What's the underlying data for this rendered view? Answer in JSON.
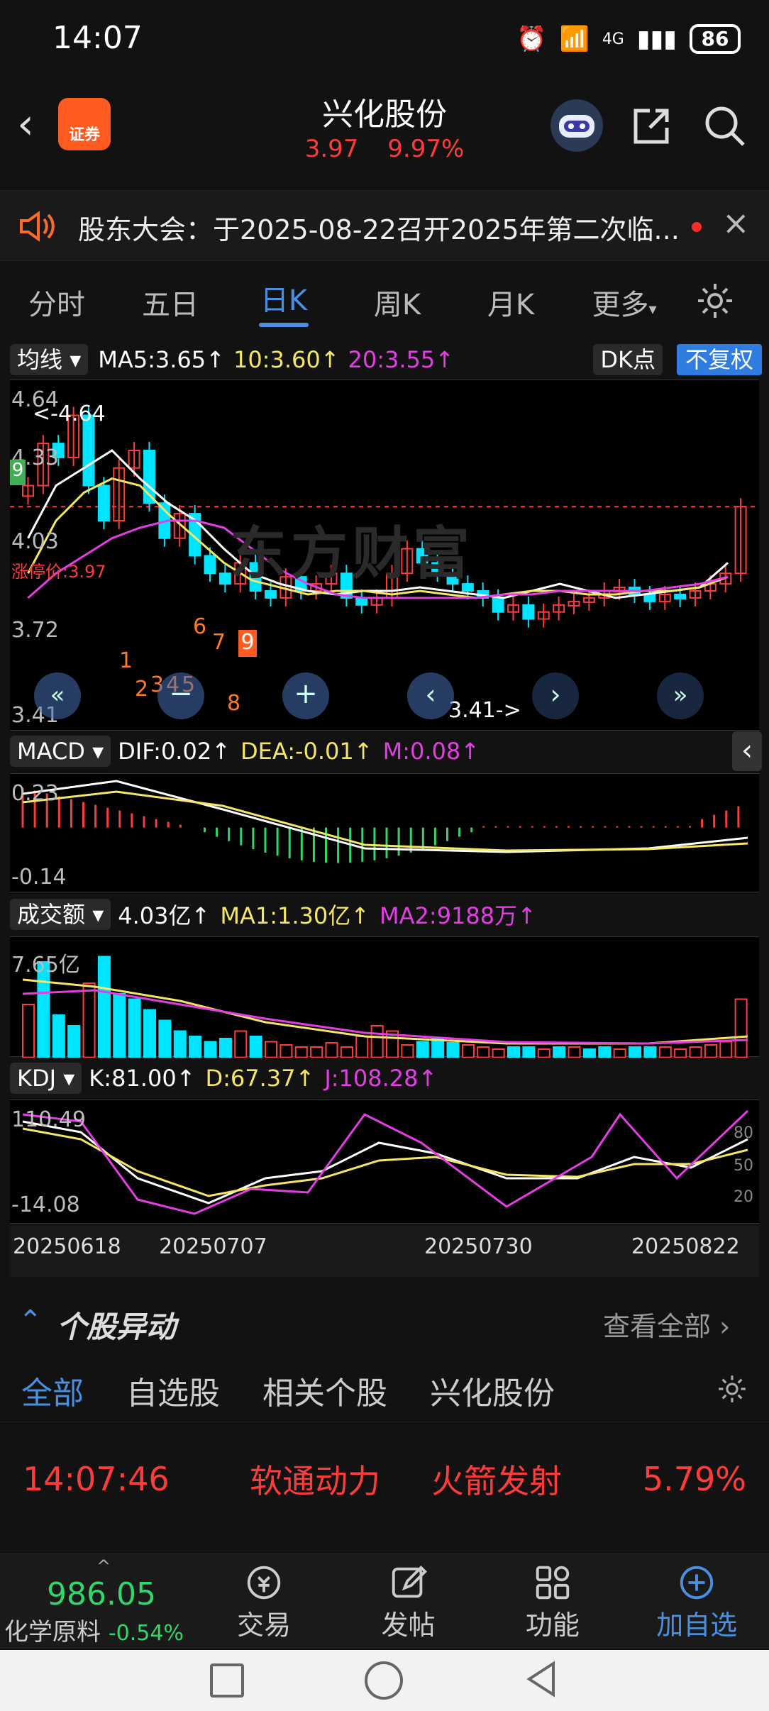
{
  "status": {
    "time": "14:07",
    "network": "4G",
    "battery": "86"
  },
  "header": {
    "title": "兴化股份",
    "price": "3.97",
    "change_pct": "9.97%",
    "logo_text": "证券"
  },
  "notice": {
    "text": "股东大会：于2025-08-22召开2025年第二次临..."
  },
  "tabs": [
    "分时",
    "五日",
    "日K",
    "周K",
    "月K",
    "更多"
  ],
  "active_tab": "日K",
  "ma_bar": {
    "selector": "均线",
    "ma5": "MA5:3.65↑",
    "ma10": "10:3.60↑",
    "ma20": "20:3.55↑",
    "dk": "DK点",
    "fq": "不复权"
  },
  "kchart": {
    "ticks": [
      "4.64",
      "4.33",
      "4.03",
      "3.72",
      "3.41"
    ],
    "high_label": "<-4.64",
    "low_label": "3.41->",
    "limit_label": "涨停价:3.97",
    "watermark": "东方财富",
    "nine_tag": "9",
    "seq_up": [
      "6",
      "7",
      "9"
    ],
    "seq_down": [
      "1",
      "2",
      "3",
      "4",
      "5",
      "8"
    ]
  },
  "macd_bar": {
    "selector": "MACD",
    "dif": "DIF:0.02↑",
    "dea": "DEA:-0.01↑",
    "m": "M:0.08↑"
  },
  "macd": {
    "ticks": [
      "0.23",
      "-0.14"
    ]
  },
  "vol_bar": {
    "selector": "成交额",
    "val": "4.03亿↑",
    "ma1": "MA1:1.30亿↑",
    "ma2": "MA2:9188万↑"
  },
  "vol": {
    "ticks": [
      "7.65亿"
    ]
  },
  "kdj_bar": {
    "selector": "KDJ",
    "k": "K:81.00↑",
    "d": "D:67.37↑",
    "j": "J:108.28↑"
  },
  "kdj": {
    "ticks": [
      "110.49",
      "-14.08"
    ],
    "right_ticks": [
      "80",
      "50",
      "20"
    ]
  },
  "dates": [
    "20250618",
    "20250707",
    "20250730",
    "20250822"
  ],
  "section": {
    "title": "个股异动",
    "view_all": "查看全部"
  },
  "filter_tabs": [
    "全部",
    "自选股",
    "相关个股",
    "兴化股份"
  ],
  "event": {
    "time": "14:07:46",
    "name": "软通动力",
    "type": "火箭发射",
    "pct": "5.79%"
  },
  "bottom_nav": {
    "index_value": "986.05",
    "index_name": "化学原料",
    "index_change": "-0.54%",
    "items": [
      "交易",
      "发帖",
      "功能",
      "加自选"
    ]
  },
  "colors": {
    "up": "#ff3b3b",
    "down": "#00e5ff",
    "accent": "#4a90e2",
    "yellow": "#f5e663",
    "magenta": "#e53de5"
  }
}
